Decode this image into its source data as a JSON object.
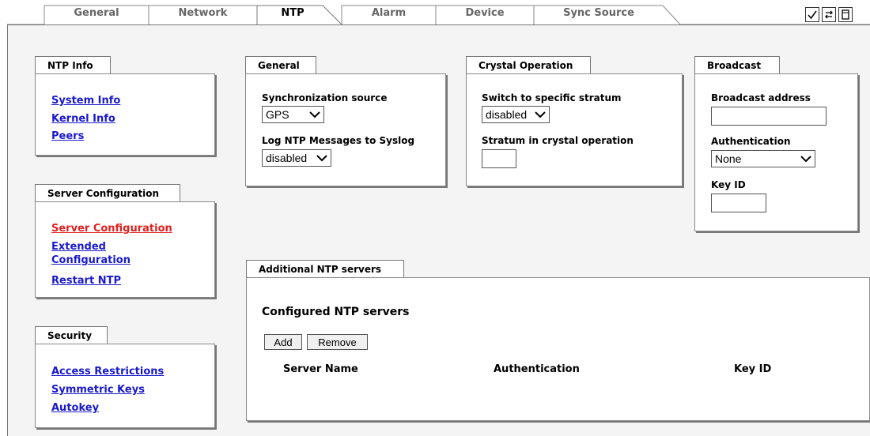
{
  "tabs": [
    {
      "label": "General"
    },
    {
      "label": "Network"
    },
    {
      "label": "NTP"
    },
    {
      "label": "Alarm"
    },
    {
      "label": "Device"
    },
    {
      "label": "Sync Source"
    }
  ],
  "toolbar_icons": [
    "check-icon",
    "refresh-icon",
    "page-icon"
  ],
  "ntp_info": {
    "title": "NTP Info",
    "links": [
      "System Info",
      "Kernel Info",
      "Peers"
    ]
  },
  "server_config": {
    "title": "Server Configuration",
    "links": [
      "Server Configuration",
      "Extended Configuration",
      "Restart NTP"
    ],
    "active_link": "Server Configuration"
  },
  "security": {
    "title": "Security",
    "links": [
      "Access Restrictions",
      "Symmetric Keys",
      "Autokey"
    ]
  },
  "general": {
    "title": "General",
    "sync_source_label": "Synchronization source",
    "sync_source_value": "GPS",
    "log_label": "Log NTP Messages to Syslog",
    "log_value": "disabled"
  },
  "crystal": {
    "title": "Crystal Operation",
    "switch_label": "Switch to specific stratum",
    "switch_value": "disabled",
    "stratum_label": "Stratum in crystal operation",
    "stratum_value": ""
  },
  "broadcast": {
    "title": "Broadcast",
    "address_label": "Broadcast address",
    "address_value": "",
    "auth_label": "Authentication",
    "auth_value": "None",
    "keyid_label": "Key ID",
    "keyid_value": ""
  },
  "additional": {
    "title": "Additional NTP servers",
    "heading": "Configured NTP servers",
    "add_label": "Add",
    "remove_label": "Remove",
    "columns": [
      "Server Name",
      "Authentication",
      "Key ID"
    ]
  },
  "colors": {
    "link": "#1a1acc",
    "active_link": "#e02020",
    "background": "#f4f4f4"
  }
}
